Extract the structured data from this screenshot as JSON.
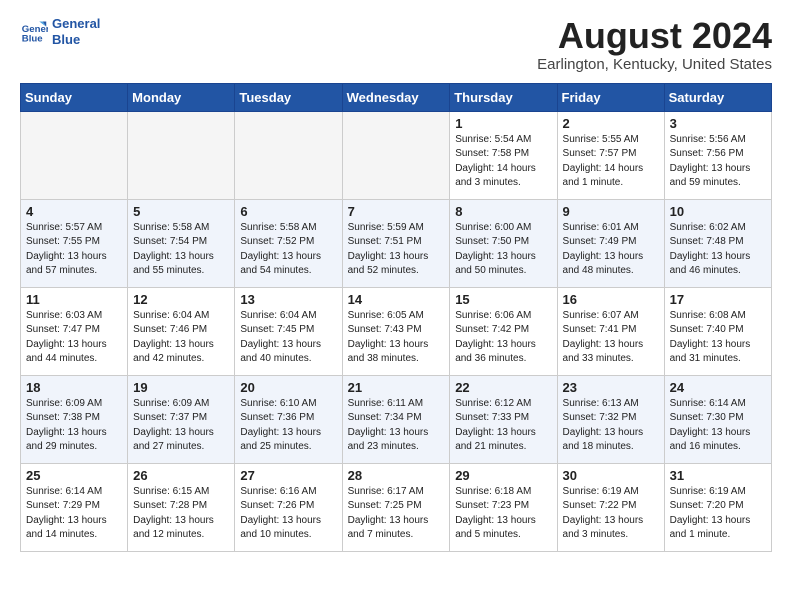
{
  "logo": {
    "line1": "General",
    "line2": "Blue"
  },
  "title": "August 2024",
  "location": "Earlington, Kentucky, United States",
  "days_of_week": [
    "Sunday",
    "Monday",
    "Tuesday",
    "Wednesday",
    "Thursday",
    "Friday",
    "Saturday"
  ],
  "weeks": [
    [
      {
        "num": "",
        "info": ""
      },
      {
        "num": "",
        "info": ""
      },
      {
        "num": "",
        "info": ""
      },
      {
        "num": "",
        "info": ""
      },
      {
        "num": "1",
        "info": "Sunrise: 5:54 AM\nSunset: 7:58 PM\nDaylight: 14 hours\nand 3 minutes."
      },
      {
        "num": "2",
        "info": "Sunrise: 5:55 AM\nSunset: 7:57 PM\nDaylight: 14 hours\nand 1 minute."
      },
      {
        "num": "3",
        "info": "Sunrise: 5:56 AM\nSunset: 7:56 PM\nDaylight: 13 hours\nand 59 minutes."
      }
    ],
    [
      {
        "num": "4",
        "info": "Sunrise: 5:57 AM\nSunset: 7:55 PM\nDaylight: 13 hours\nand 57 minutes."
      },
      {
        "num": "5",
        "info": "Sunrise: 5:58 AM\nSunset: 7:54 PM\nDaylight: 13 hours\nand 55 minutes."
      },
      {
        "num": "6",
        "info": "Sunrise: 5:58 AM\nSunset: 7:52 PM\nDaylight: 13 hours\nand 54 minutes."
      },
      {
        "num": "7",
        "info": "Sunrise: 5:59 AM\nSunset: 7:51 PM\nDaylight: 13 hours\nand 52 minutes."
      },
      {
        "num": "8",
        "info": "Sunrise: 6:00 AM\nSunset: 7:50 PM\nDaylight: 13 hours\nand 50 minutes."
      },
      {
        "num": "9",
        "info": "Sunrise: 6:01 AM\nSunset: 7:49 PM\nDaylight: 13 hours\nand 48 minutes."
      },
      {
        "num": "10",
        "info": "Sunrise: 6:02 AM\nSunset: 7:48 PM\nDaylight: 13 hours\nand 46 minutes."
      }
    ],
    [
      {
        "num": "11",
        "info": "Sunrise: 6:03 AM\nSunset: 7:47 PM\nDaylight: 13 hours\nand 44 minutes."
      },
      {
        "num": "12",
        "info": "Sunrise: 6:04 AM\nSunset: 7:46 PM\nDaylight: 13 hours\nand 42 minutes."
      },
      {
        "num": "13",
        "info": "Sunrise: 6:04 AM\nSunset: 7:45 PM\nDaylight: 13 hours\nand 40 minutes."
      },
      {
        "num": "14",
        "info": "Sunrise: 6:05 AM\nSunset: 7:43 PM\nDaylight: 13 hours\nand 38 minutes."
      },
      {
        "num": "15",
        "info": "Sunrise: 6:06 AM\nSunset: 7:42 PM\nDaylight: 13 hours\nand 36 minutes."
      },
      {
        "num": "16",
        "info": "Sunrise: 6:07 AM\nSunset: 7:41 PM\nDaylight: 13 hours\nand 33 minutes."
      },
      {
        "num": "17",
        "info": "Sunrise: 6:08 AM\nSunset: 7:40 PM\nDaylight: 13 hours\nand 31 minutes."
      }
    ],
    [
      {
        "num": "18",
        "info": "Sunrise: 6:09 AM\nSunset: 7:38 PM\nDaylight: 13 hours\nand 29 minutes."
      },
      {
        "num": "19",
        "info": "Sunrise: 6:09 AM\nSunset: 7:37 PM\nDaylight: 13 hours\nand 27 minutes."
      },
      {
        "num": "20",
        "info": "Sunrise: 6:10 AM\nSunset: 7:36 PM\nDaylight: 13 hours\nand 25 minutes."
      },
      {
        "num": "21",
        "info": "Sunrise: 6:11 AM\nSunset: 7:34 PM\nDaylight: 13 hours\nand 23 minutes."
      },
      {
        "num": "22",
        "info": "Sunrise: 6:12 AM\nSunset: 7:33 PM\nDaylight: 13 hours\nand 21 minutes."
      },
      {
        "num": "23",
        "info": "Sunrise: 6:13 AM\nSunset: 7:32 PM\nDaylight: 13 hours\nand 18 minutes."
      },
      {
        "num": "24",
        "info": "Sunrise: 6:14 AM\nSunset: 7:30 PM\nDaylight: 13 hours\nand 16 minutes."
      }
    ],
    [
      {
        "num": "25",
        "info": "Sunrise: 6:14 AM\nSunset: 7:29 PM\nDaylight: 13 hours\nand 14 minutes."
      },
      {
        "num": "26",
        "info": "Sunrise: 6:15 AM\nSunset: 7:28 PM\nDaylight: 13 hours\nand 12 minutes."
      },
      {
        "num": "27",
        "info": "Sunrise: 6:16 AM\nSunset: 7:26 PM\nDaylight: 13 hours\nand 10 minutes."
      },
      {
        "num": "28",
        "info": "Sunrise: 6:17 AM\nSunset: 7:25 PM\nDaylight: 13 hours\nand 7 minutes."
      },
      {
        "num": "29",
        "info": "Sunrise: 6:18 AM\nSunset: 7:23 PM\nDaylight: 13 hours\nand 5 minutes."
      },
      {
        "num": "30",
        "info": "Sunrise: 6:19 AM\nSunset: 7:22 PM\nDaylight: 13 hours\nand 3 minutes."
      },
      {
        "num": "31",
        "info": "Sunrise: 6:19 AM\nSunset: 7:20 PM\nDaylight: 13 hours\nand 1 minute."
      }
    ]
  ]
}
